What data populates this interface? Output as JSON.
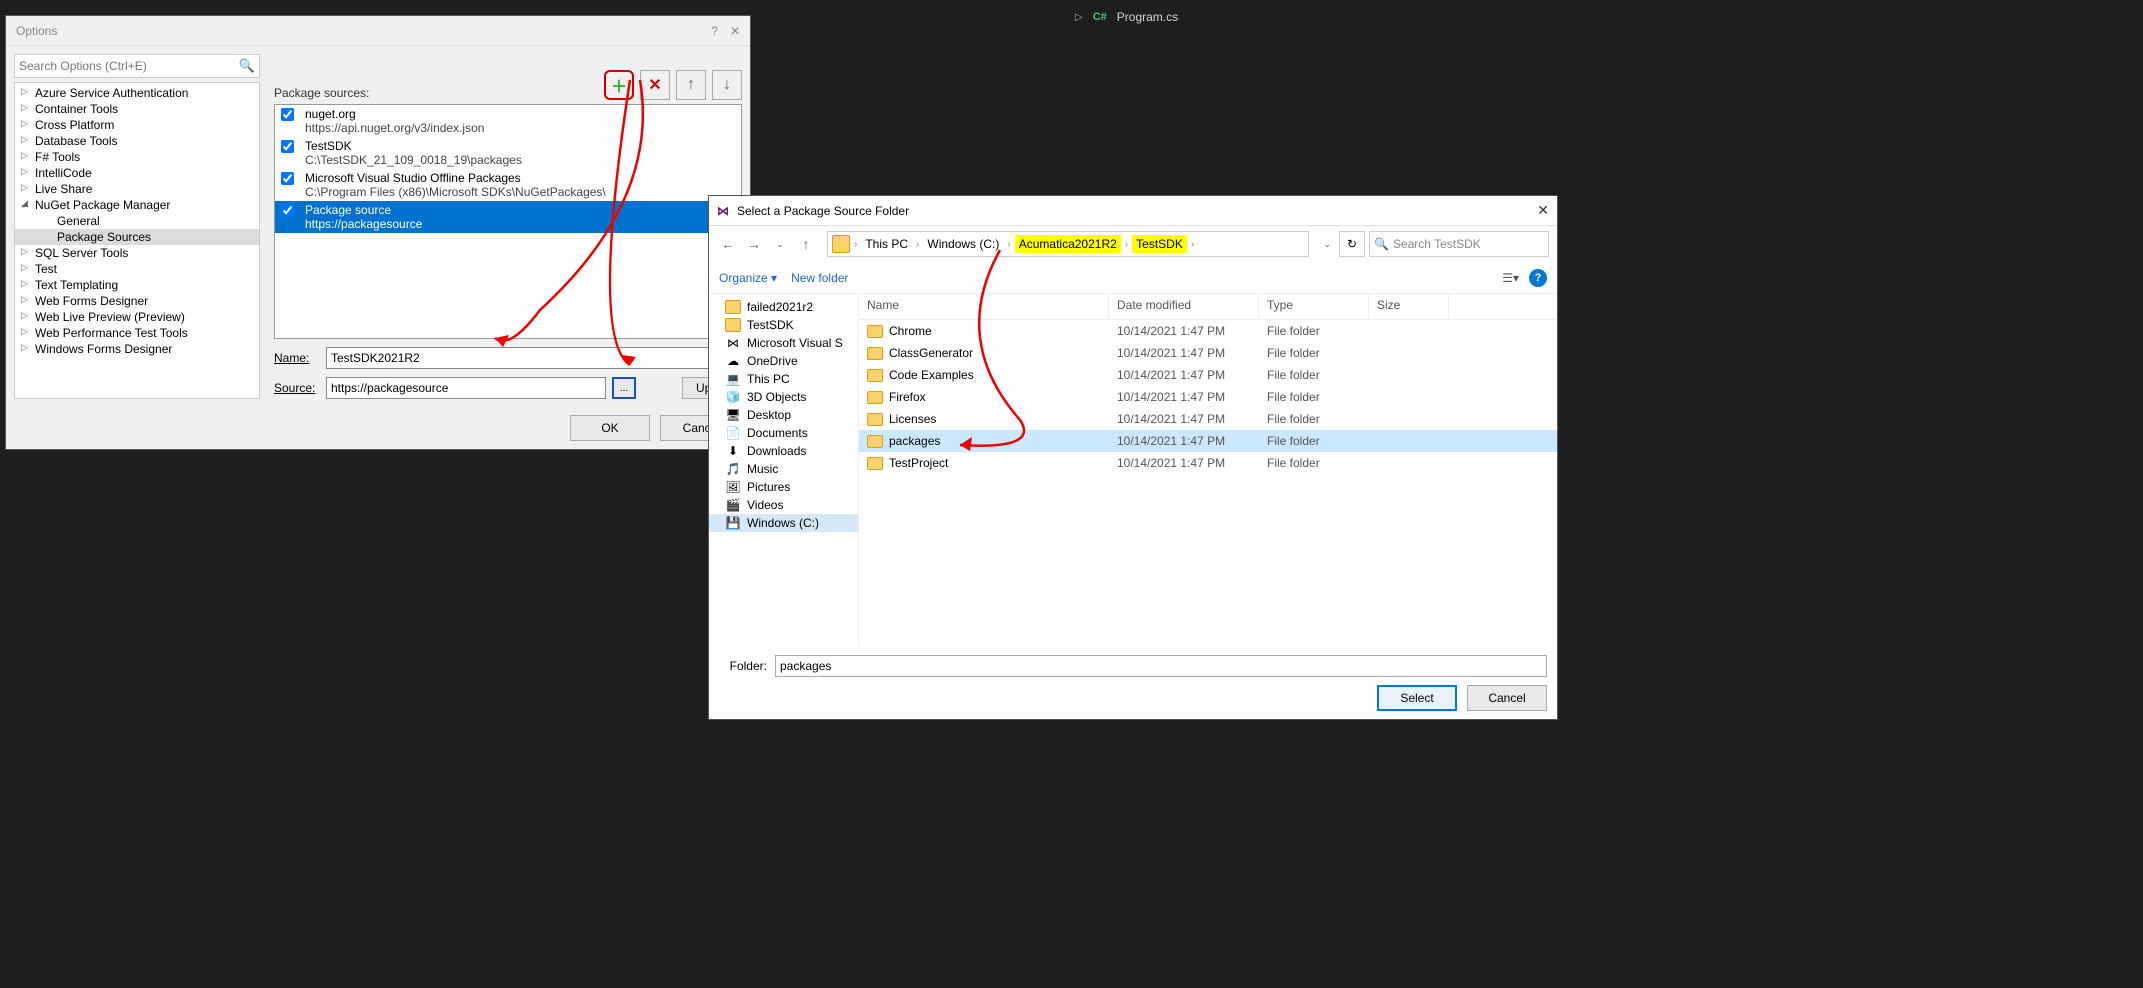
{
  "editor_tab": {
    "file": "Program.cs"
  },
  "options_dialog": {
    "title": "Options",
    "search_placeholder": "Search Options (Ctrl+E)",
    "tree": [
      {
        "label": "Azure Service Authentication",
        "expand": "collapsed"
      },
      {
        "label": "Container Tools",
        "expand": "collapsed"
      },
      {
        "label": "Cross Platform",
        "expand": "collapsed"
      },
      {
        "label": "Database Tools",
        "expand": "collapsed"
      },
      {
        "label": "F# Tools",
        "expand": "collapsed"
      },
      {
        "label": "IntelliCode",
        "expand": "collapsed"
      },
      {
        "label": "Live Share",
        "expand": "collapsed"
      },
      {
        "label": "NuGet Package Manager",
        "expand": "expanded",
        "children": [
          {
            "label": "General"
          },
          {
            "label": "Package Sources",
            "selected": true
          }
        ]
      },
      {
        "label": "SQL Server Tools",
        "expand": "collapsed"
      },
      {
        "label": "Test",
        "expand": "collapsed"
      },
      {
        "label": "Text Templating",
        "expand": "collapsed"
      },
      {
        "label": "Web Forms Designer",
        "expand": "collapsed"
      },
      {
        "label": "Web Live Preview (Preview)",
        "expand": "collapsed"
      },
      {
        "label": "Web Performance Test Tools",
        "expand": "collapsed"
      },
      {
        "label": "Windows Forms Designer",
        "expand": "collapsed"
      }
    ],
    "sources_label": "Package sources:",
    "sources": [
      {
        "name": "nuget.org",
        "path": "https://api.nuget.org/v3/index.json",
        "checked": true
      },
      {
        "name": "TestSDK",
        "path": "C:\\TestSDK_21_109_0018_19\\packages",
        "checked": true
      },
      {
        "name": "Microsoft Visual Studio Offline Packages",
        "path": "C:\\Program Files (x86)\\Microsoft SDKs\\NuGetPackages\\",
        "checked": true
      },
      {
        "name": "Package source",
        "path": "https://packagesource",
        "checked": true,
        "selected": true
      }
    ],
    "name_label": "Name:",
    "name_value": "TestSDK2021R2",
    "source_label": "Source:",
    "source_value": "https://packagesource",
    "browse_btn": "...",
    "update_btn": "Updat",
    "ok_btn": "OK",
    "cancel_btn": "Cance"
  },
  "folder_dialog": {
    "title": "Select a Package Source Folder",
    "breadcrumb": [
      {
        "label": "This PC"
      },
      {
        "label": "Windows (C:)"
      },
      {
        "label": "Acumatica2021R2",
        "highlight": true
      },
      {
        "label": "TestSDK",
        "highlight": true
      }
    ],
    "search_placeholder": "Search TestSDK",
    "organize": "Organize",
    "new_folder": "New folder",
    "tree": [
      {
        "label": "failed2021r2",
        "icon": "folder"
      },
      {
        "label": "TestSDK",
        "icon": "folder"
      },
      {
        "label": "Microsoft Visual S",
        "icon": "vs"
      },
      {
        "label": "OneDrive",
        "icon": "cloud"
      },
      {
        "label": "This PC",
        "icon": "pc"
      },
      {
        "label": "3D Objects",
        "icon": "3d"
      },
      {
        "label": "Desktop",
        "icon": "desktop"
      },
      {
        "label": "Documents",
        "icon": "doc"
      },
      {
        "label": "Downloads",
        "icon": "down"
      },
      {
        "label": "Music",
        "icon": "music"
      },
      {
        "label": "Pictures",
        "icon": "pic"
      },
      {
        "label": "Videos",
        "icon": "vid"
      },
      {
        "label": "Windows (C:)",
        "icon": "drive",
        "selected": true
      }
    ],
    "columns": {
      "name": "Name",
      "date": "Date modified",
      "type": "Type",
      "size": "Size"
    },
    "files": [
      {
        "name": "Chrome",
        "date": "10/14/2021 1:47 PM",
        "type": "File folder"
      },
      {
        "name": "ClassGenerator",
        "date": "10/14/2021 1:47 PM",
        "type": "File folder"
      },
      {
        "name": "Code Examples",
        "date": "10/14/2021 1:47 PM",
        "type": "File folder"
      },
      {
        "name": "Firefox",
        "date": "10/14/2021 1:47 PM",
        "type": "File folder"
      },
      {
        "name": "Licenses",
        "date": "10/14/2021 1:47 PM",
        "type": "File folder"
      },
      {
        "name": "packages",
        "date": "10/14/2021 1:47 PM",
        "type": "File folder",
        "selected": true
      },
      {
        "name": "TestProject",
        "date": "10/14/2021 1:47 PM",
        "type": "File folder"
      }
    ],
    "folder_label": "Folder:",
    "folder_value": "packages",
    "select_btn": "Select",
    "cancel_btn": "Cancel"
  }
}
